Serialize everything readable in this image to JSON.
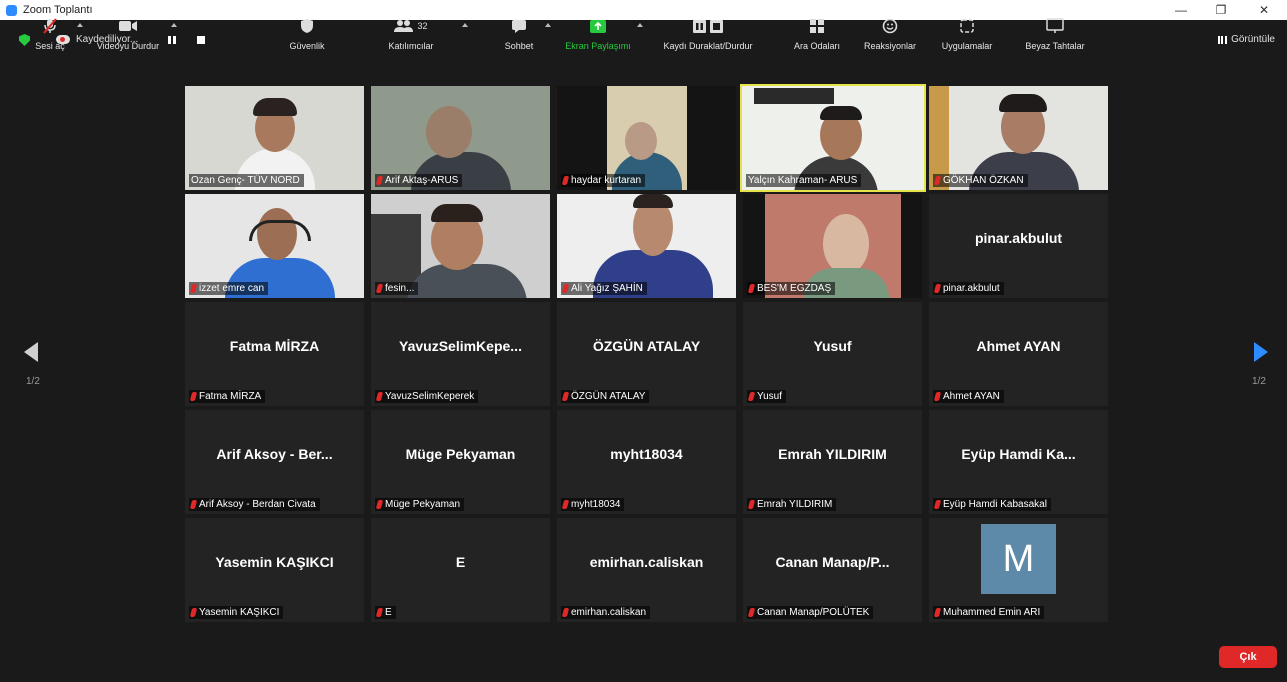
{
  "window": {
    "title": "Zoom Toplantı",
    "minimize": "—",
    "restore": "❐",
    "close": "✕"
  },
  "topbar": {
    "recording_text": "Kaydediliyor...",
    "view_label": "Görüntüle"
  },
  "gallery": {
    "page_left": "1/2",
    "page_right": "1/2",
    "tiles": [
      {
        "label": "Ozan Genç- TÜV NORD",
        "display": "",
        "muted": false
      },
      {
        "label": "Arif Aktaş-ARUS",
        "display": "",
        "muted": true
      },
      {
        "label": "haydar kurtaran",
        "display": "",
        "muted": true
      },
      {
        "label": "Yalçın Kahraman- ARUS",
        "display": "",
        "muted": false
      },
      {
        "label": "GÖKHAN ÖZKAN",
        "display": "",
        "muted": true
      },
      {
        "label": "izzet emre can",
        "display": "",
        "muted": true
      },
      {
        "label": "fesin...",
        "display": "",
        "muted": true
      },
      {
        "label": "Ali Yağız ŞAHİN",
        "display": "",
        "muted": true
      },
      {
        "label": "BES'M EGZDAŞ",
        "display": "",
        "muted": true
      },
      {
        "label": "pinar.akbulut",
        "display": "pinar.akbulut",
        "muted": true
      },
      {
        "label": "Fatma MİRZA",
        "display": "Fatma MİRZA",
        "muted": true
      },
      {
        "label": "YavuzSelimKeperek",
        "display": "YavuzSelimKepe...",
        "muted": true
      },
      {
        "label": "ÖZGÜN ATALAY",
        "display": "ÖZGÜN ATALAY",
        "muted": true
      },
      {
        "label": "Yusuf",
        "display": "Yusuf",
        "muted": true
      },
      {
        "label": "Ahmet AYAN",
        "display": "Ahmet AYAN",
        "muted": true
      },
      {
        "label": "Arif Aksoy - Berdan Civata",
        "display": "Arif Aksoy - Ber...",
        "muted": true
      },
      {
        "label": "Müge Pekyaman",
        "display": "Müge Pekyaman",
        "muted": true
      },
      {
        "label": "myht18034",
        "display": "myht18034",
        "muted": true
      },
      {
        "label": "Emrah YILDIRIM",
        "display": "Emrah YILDIRIM",
        "muted": true
      },
      {
        "label": "Eyüp Hamdi Kabasakal",
        "display": "Eyüp Hamdi Ka...",
        "muted": true
      },
      {
        "label": "Yasemin KAŞIKCI",
        "display": "Yasemin KAŞIKCI",
        "muted": true
      },
      {
        "label": "E",
        "display": "E",
        "muted": true
      },
      {
        "label": "emirhan.caliskan",
        "display": "emirhan.caliskan",
        "muted": true
      },
      {
        "label": "Canan Manap/POLÜTEK",
        "display": "Canan  Manap/P...",
        "muted": true
      },
      {
        "label": "Muhammed Emin ARI",
        "display": "",
        "avatar_letter": "M",
        "muted": true
      }
    ]
  },
  "toolbar": {
    "unmute": "Sesi aç",
    "stop_video": "Videoyu Durdur",
    "security": "Güvenlik",
    "participants": "Katılımcılar",
    "participants_count": "32",
    "chat": "Sohbet",
    "share_screen": "Ekran Paylaşımı",
    "pause_stop_recording": "Kaydı Duraklat/Durdur",
    "breakout_rooms": "Ara Odaları",
    "reactions": "Reaksiyonlar",
    "apps": "Uygulamalar",
    "whiteboards": "Beyaz Tahtalar",
    "leave": "Çık"
  },
  "colors": {
    "accent": "#2d8cff",
    "leave": "#e02828",
    "active_speaker": "#e6e24a",
    "share": "#27c93f"
  }
}
